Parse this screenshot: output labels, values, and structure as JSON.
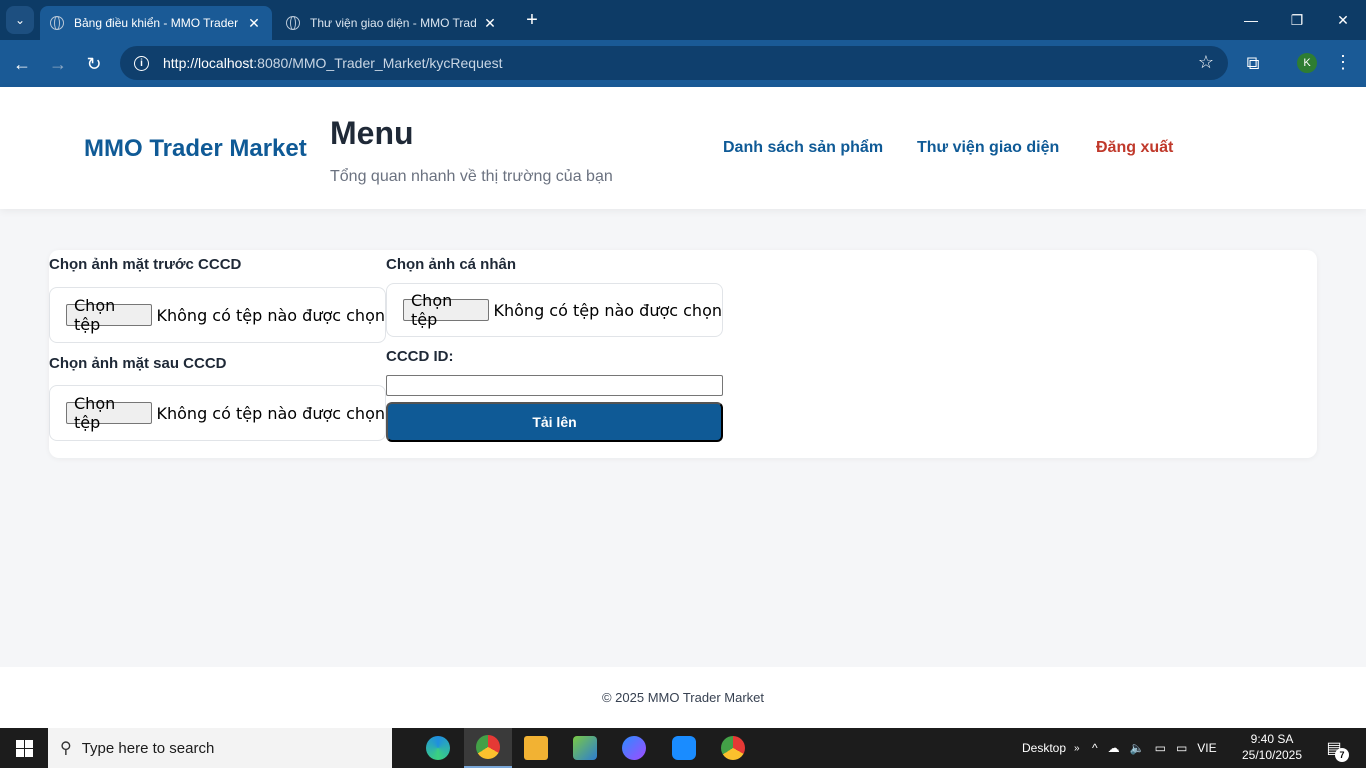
{
  "browser": {
    "tabs": [
      {
        "title": "Bảng điều khiển - MMO Trader Market",
        "active": true
      },
      {
        "title": "Thư viện giao diện - MMO Trader Market",
        "active": false
      }
    ],
    "url_host": "http://localhost",
    "url_path": ":8080/MMO_Trader_Market/kycRequest",
    "profile_initial": "K"
  },
  "header": {
    "brand": "MMO Trader Market",
    "title": "Menu",
    "subtitle": "Tổng quan nhanh về thị trường của bạn",
    "nav": {
      "products": "Danh sách sản phẩm",
      "themes": "Thư viện giao diện",
      "logout": "Đăng xuất"
    }
  },
  "form": {
    "front_label": "Chọn ảnh mặt trước CCCD",
    "back_label": "Chọn ảnh mặt sau CCCD",
    "selfie_label": "Chọn ảnh cá nhân",
    "cccd_label": "CCCD ID:",
    "cccd_value": "",
    "choose_file": "Chọn tệp",
    "no_file": "Không có tệp nào được chọn",
    "submit": "Tải lên"
  },
  "footer": {
    "text": "© 2025 MMO Trader Market"
  },
  "taskbar": {
    "search_placeholder": "Type here to search",
    "desktop_label": "Desktop",
    "language": "VIE",
    "time": "9:40 SA",
    "date": "25/10/2025",
    "notification_count": "7"
  }
}
